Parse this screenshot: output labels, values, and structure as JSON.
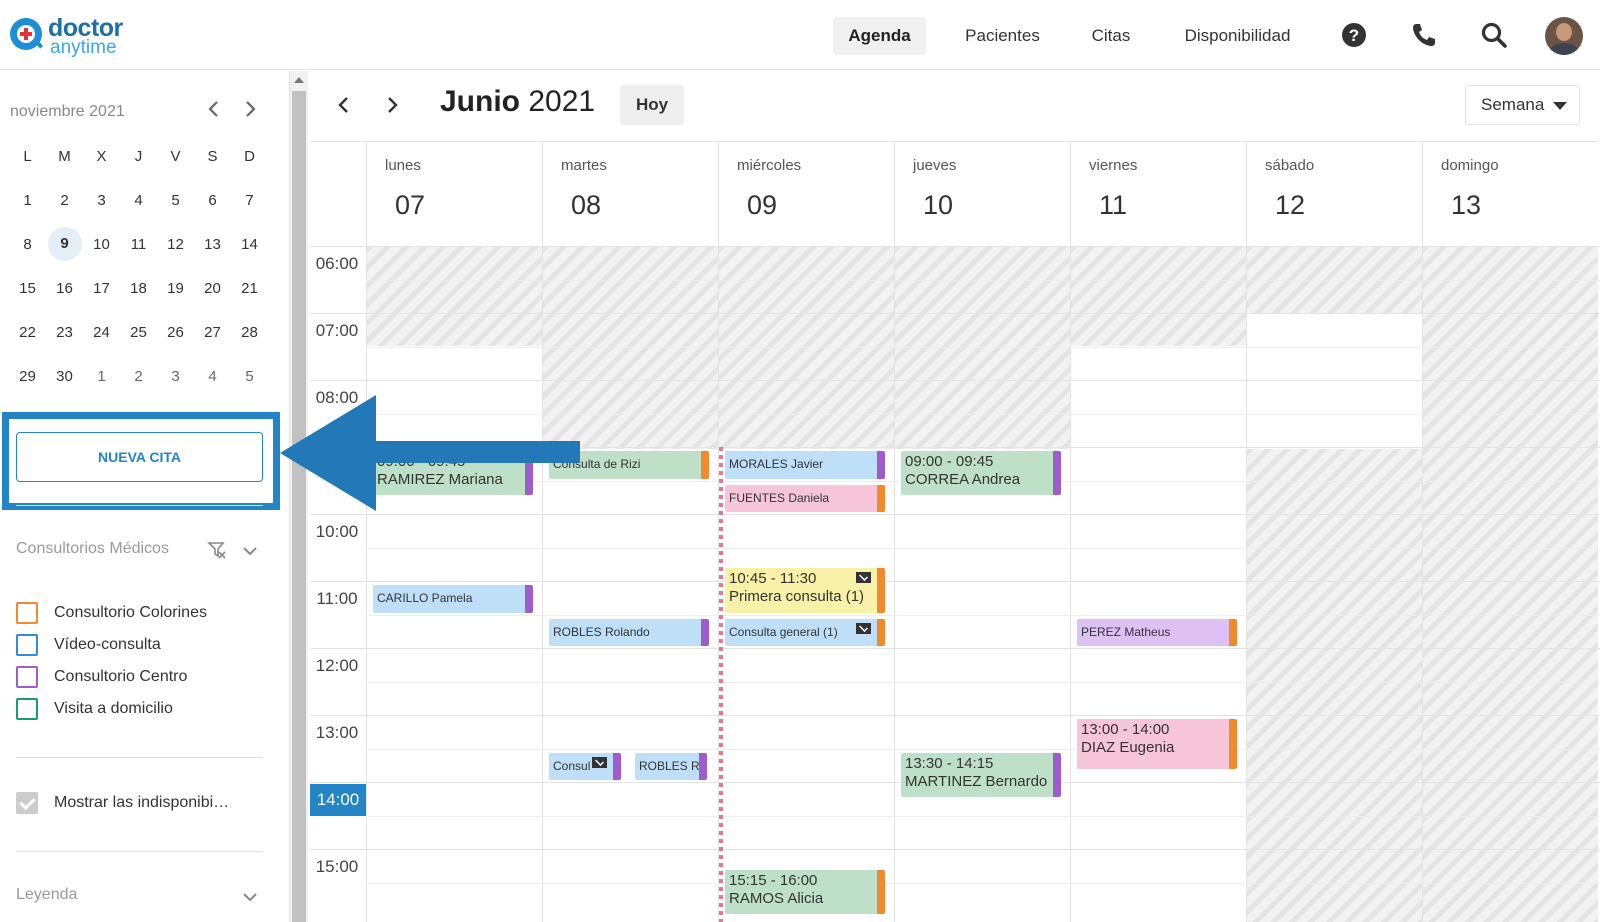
{
  "header": {
    "logo_top": "doctor",
    "logo_bottom": "anytime",
    "nav": [
      "Agenda",
      "Pacientes",
      "Citas",
      "Disponibilidad"
    ],
    "active_nav": "Agenda",
    "icons": [
      "help-icon",
      "phone-icon",
      "search-icon"
    ]
  },
  "mini_calendar": {
    "title": "noviembre 2021",
    "weekdays": [
      "L",
      "M",
      "X",
      "J",
      "V",
      "S",
      "D"
    ],
    "weeks": [
      [
        "1",
        "2",
        "3",
        "4",
        "5",
        "6",
        "7"
      ],
      [
        "8",
        "9",
        "10",
        "11",
        "12",
        "13",
        "14"
      ],
      [
        "15",
        "16",
        "17",
        "18",
        "19",
        "20",
        "21"
      ],
      [
        "22",
        "23",
        "24",
        "25",
        "26",
        "27",
        "28"
      ],
      [
        "29",
        "30",
        "1",
        "2",
        "3",
        "4",
        "5"
      ]
    ],
    "today": "9"
  },
  "sidebar": {
    "new_button": "NUEVA CITA",
    "filters_title": "Consultorios Médicos",
    "consultorios": [
      {
        "label": "Consultorio Colorines",
        "color": "#f08a2c"
      },
      {
        "label": "Vídeo-consulta",
        "color": "#2d8fd6"
      },
      {
        "label": "Consultorio Centro",
        "color": "#a05ccc"
      },
      {
        "label": "Visita a domicilio",
        "color": "#1a9a7a"
      }
    ],
    "show_unavailable": "Mostrar las indisponibi…",
    "legend_title": "Leyenda"
  },
  "calendar": {
    "month": "Junio",
    "year": "2021",
    "today_button": "Hoy",
    "view_select": "Semana",
    "days": [
      {
        "name": "lunes",
        "num": "07"
      },
      {
        "name": "martes",
        "num": "08"
      },
      {
        "name": "miércoles",
        "num": "09"
      },
      {
        "name": "jueves",
        "num": "10"
      },
      {
        "name": "viernes",
        "num": "11"
      },
      {
        "name": "sábado",
        "num": "12"
      },
      {
        "name": "domingo",
        "num": "13"
      }
    ],
    "hours": [
      "06:00",
      "07:00",
      "08:00",
      "09:00",
      "10:00",
      "11:00",
      "12:00",
      "13:00",
      "14:00",
      "15:00"
    ],
    "current_time": "14:00",
    "events": [
      {
        "day": 0,
        "start": "09:00",
        "end": "09:45",
        "line1": "09:00 - 09:45",
        "line2": "RAMIREZ Mariana",
        "bg": "#bfe0c8",
        "bar": "#a05ccc",
        "style": "double"
      },
      {
        "day": 1,
        "start": "09:00",
        "end": "09:30",
        "line1": "Consulta de Rizi",
        "bg": "#bfe0c8",
        "bar": "#f08a2c",
        "style": "single"
      },
      {
        "day": 2,
        "start": "09:00",
        "end": "09:30",
        "line1": "MORALES Javier",
        "bg": "#bedff7",
        "bar": "#a05ccc",
        "style": "single"
      },
      {
        "day": 2,
        "start": "09:30",
        "end": "10:00",
        "line1": "FUENTES Daniela",
        "bg": "#f6c5da",
        "bar": "#f08a2c",
        "style": "single"
      },
      {
        "day": 3,
        "start": "09:00",
        "end": "09:45",
        "line1": "09:00 - 09:45",
        "line2": "CORREA Andrea",
        "bg": "#bfe0c8",
        "bar": "#a05ccc",
        "style": "double"
      },
      {
        "day": 0,
        "start": "11:00",
        "end": "11:30",
        "line1": "CARILLO Pamela",
        "bg": "#bedff7",
        "bar": "#a05ccc",
        "style": "single"
      },
      {
        "day": 2,
        "start": "10:45",
        "end": "11:30",
        "line1": "10:45 - 11:30",
        "line2": "Primera consulta (1)",
        "bg": "#f9f1a7",
        "bar": "#f08a2c",
        "style": "double",
        "mail": true
      },
      {
        "day": 1,
        "start": "11:30",
        "end": "12:00",
        "line1": "ROBLES Rolando",
        "bg": "#bedff7",
        "bar": "#a05ccc",
        "style": "single"
      },
      {
        "day": 2,
        "start": "11:30",
        "end": "12:00",
        "line1": "Consulta general (1)",
        "bg": "#bedff7",
        "bar": "#f08a2c",
        "style": "single",
        "mail": true
      },
      {
        "day": 4,
        "start": "11:30",
        "end": "12:00",
        "line1": "PEREZ Matheus",
        "bg": "#dec1f3",
        "bar": "#f08a2c",
        "style": "single"
      },
      {
        "day": 4,
        "start": "13:00",
        "end": "13:50",
        "line1": "13:00 - 14:00",
        "line2": "DIAZ Eugenia",
        "bg": "#f6c5da",
        "bar": "#f08a2c",
        "style": "double"
      },
      {
        "day": 1,
        "start": "13:30",
        "end": "14:00",
        "line1": "Consul",
        "bg": "#bedff7",
        "bar": "#a05ccc",
        "style": "single",
        "mail": true,
        "half": "left"
      },
      {
        "day": 1,
        "start": "13:30",
        "end": "14:00",
        "line1": "ROBLES Ro",
        "bg": "#bedff7",
        "bar": "#a05ccc",
        "style": "single",
        "half": "right"
      },
      {
        "day": 3,
        "start": "13:30",
        "end": "14:15",
        "line1": "13:30 - 14:15",
        "line2": "MARTINEZ Bernardo",
        "bg": "#bfe0c8",
        "bar": "#a05ccc",
        "style": "double"
      },
      {
        "day": 2,
        "start": "15:15",
        "end": "16:00",
        "line1": "15:15 - 16:00",
        "line2": "RAMOS Alicia",
        "bg": "#bfe0c8",
        "bar": "#f08a2c",
        "style": "double"
      }
    ]
  },
  "colors": {
    "accent": "#2384c6",
    "hatch": "#e4e4e4"
  }
}
